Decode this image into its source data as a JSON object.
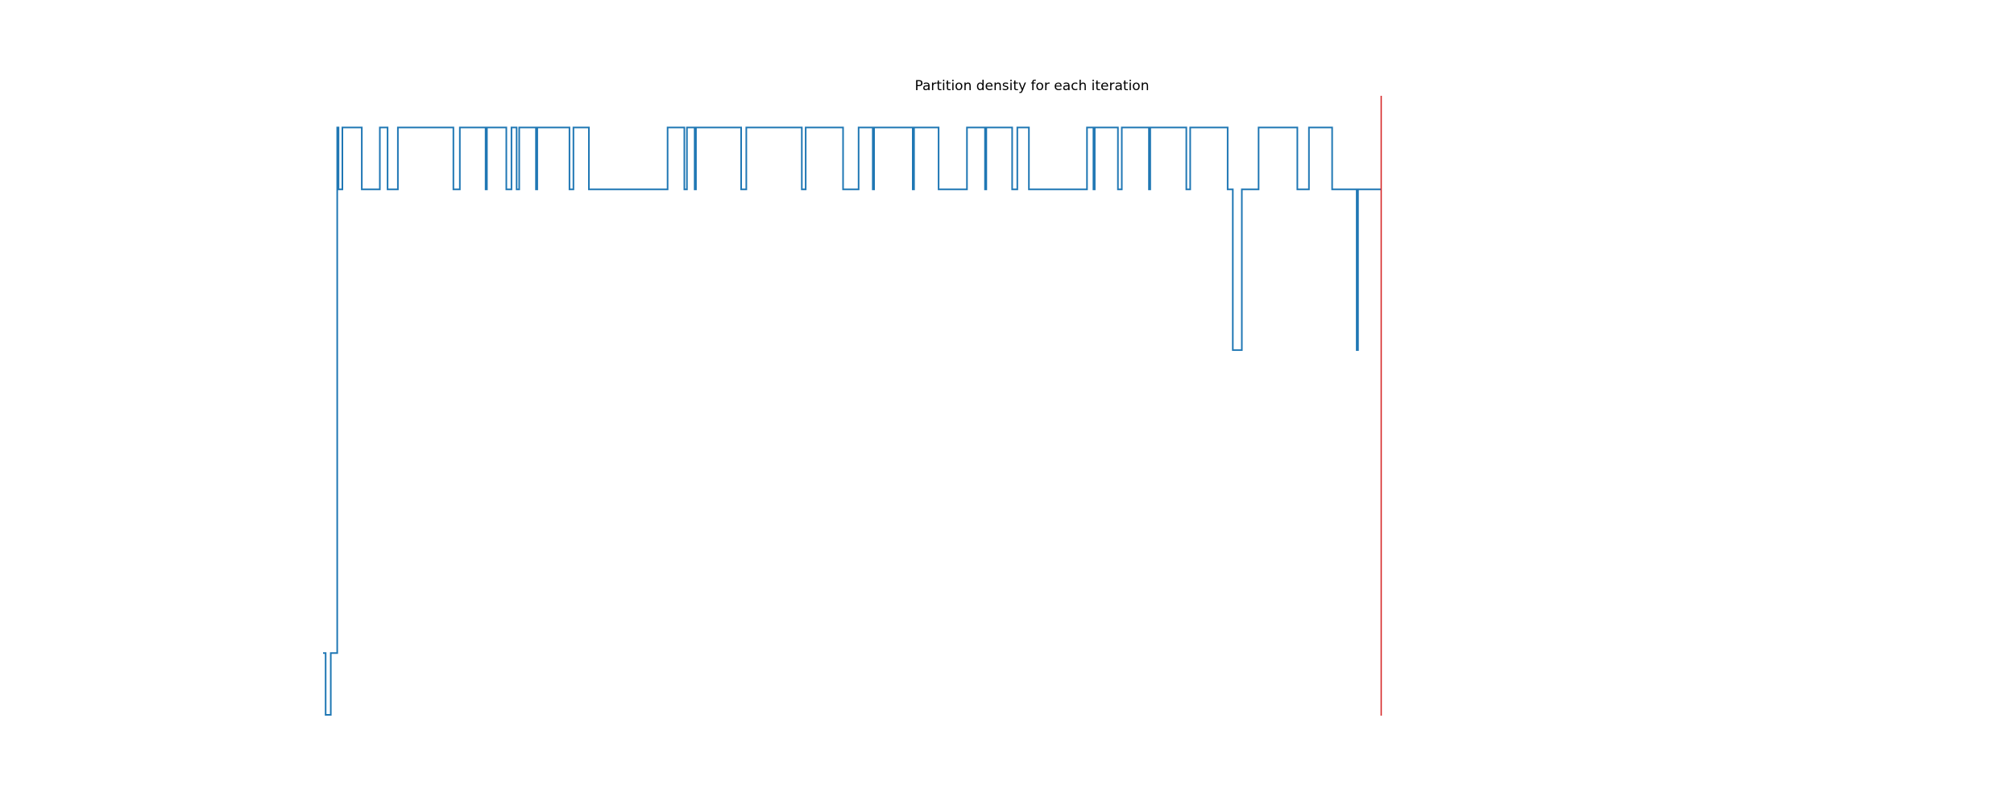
{
  "chart_data": {
    "type": "line",
    "title": "Partition density for each iteration",
    "xlabel": "",
    "ylabel": "",
    "axes_visible": false,
    "grid": false,
    "legend": "none",
    "xlim": [
      0,
      1100
    ],
    "ylim": [
      0,
      1
    ],
    "series": [
      {
        "color": "#1f77b4",
        "drawstyle": "steps-post",
        "points": [
          [
            0,
            0.1
          ],
          [
            2,
            0.0
          ],
          [
            6,
            0.1
          ],
          [
            11,
            0.95
          ],
          [
            12,
            0.85
          ],
          [
            15,
            0.95
          ],
          [
            30,
            0.85
          ],
          [
            44,
            0.95
          ],
          [
            50,
            0.85
          ],
          [
            58,
            0.95
          ],
          [
            101,
            0.85
          ],
          [
            106,
            0.95
          ],
          [
            126,
            0.85
          ],
          [
            127,
            0.95
          ],
          [
            142,
            0.85
          ],
          [
            146,
            0.95
          ],
          [
            150,
            0.85
          ],
          [
            152,
            0.95
          ],
          [
            165,
            0.85
          ],
          [
            166,
            0.95
          ],
          [
            191,
            0.85
          ],
          [
            194,
            0.95
          ],
          [
            206,
            0.85
          ],
          [
            267,
            0.95
          ],
          [
            280,
            0.85
          ],
          [
            282,
            0.95
          ],
          [
            288,
            0.85
          ],
          [
            289,
            0.95
          ],
          [
            324,
            0.85
          ],
          [
            328,
            0.95
          ],
          [
            371,
            0.85
          ],
          [
            374,
            0.95
          ],
          [
            403,
            0.85
          ],
          [
            415,
            0.95
          ],
          [
            426,
            0.85
          ],
          [
            427,
            0.95
          ],
          [
            457,
            0.85
          ],
          [
            458,
            0.95
          ],
          [
            477,
            0.85
          ],
          [
            499,
            0.95
          ],
          [
            513,
            0.85
          ],
          [
            514,
            0.95
          ],
          [
            534,
            0.85
          ],
          [
            538,
            0.95
          ],
          [
            547,
            0.85
          ],
          [
            592,
            0.95
          ],
          [
            597,
            0.85
          ],
          [
            598,
            0.95
          ],
          [
            616,
            0.85
          ],
          [
            619,
            0.95
          ],
          [
            640,
            0.85
          ],
          [
            641,
            0.95
          ],
          [
            669,
            0.85
          ],
          [
            672,
            0.95
          ],
          [
            701,
            0.85
          ],
          [
            705,
            0.59
          ],
          [
            712,
            0.85
          ],
          [
            725,
            0.95
          ],
          [
            755,
            0.85
          ],
          [
            764,
            0.95
          ],
          [
            782,
            0.85
          ],
          [
            800,
            0.85
          ],
          [
            801,
            0.59
          ],
          [
            802,
            0.85
          ],
          [
            820,
            0.85
          ]
        ]
      }
    ],
    "markers": [
      {
        "type": "vline",
        "x": 820,
        "color": "#d62728"
      }
    ]
  }
}
